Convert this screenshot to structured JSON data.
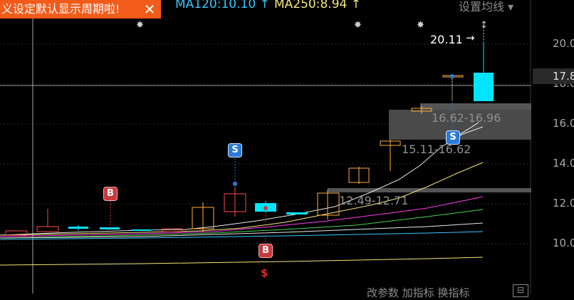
{
  "toast": {
    "text": "义设定默认显示周期啦!",
    "close": "✕"
  },
  "ma_legend": [
    {
      "label": "MA120:10.10 ↑",
      "color": "#37c7ff"
    },
    {
      "label": "MA250:8.94 ↑",
      "color": "#f2e77a"
    }
  ],
  "ma_settings": "设置均线 ▾",
  "y_axis": {
    "labels": [
      "20.0",
      "18.0",
      "16.0",
      "14.0",
      "12.0",
      "10.0"
    ]
  },
  "current_price": "17.8",
  "zones": [
    {
      "label": "16.62-16.96"
    },
    {
      "label": "15.11-16.62"
    },
    {
      "label": "12.49-12.71"
    }
  ],
  "peak_label": "20.11",
  "markers": {
    "s": "S",
    "b": "B",
    "small": "$"
  },
  "bottom_tools": "改参数  加指标  换指标",
  "corner_button": "⊟",
  "stars": [
    "✸",
    "✸",
    "✸",
    "↕"
  ],
  "colors": {
    "up": "#ff4a4a",
    "down": "#00e5ff",
    "ma_white": "#e8e8e8",
    "ma_yellow": "#f2e77a",
    "ma_magenta": "#ff3cf0",
    "ma_green": "#48d24a",
    "ma_blue": "#37c7ff"
  }
}
